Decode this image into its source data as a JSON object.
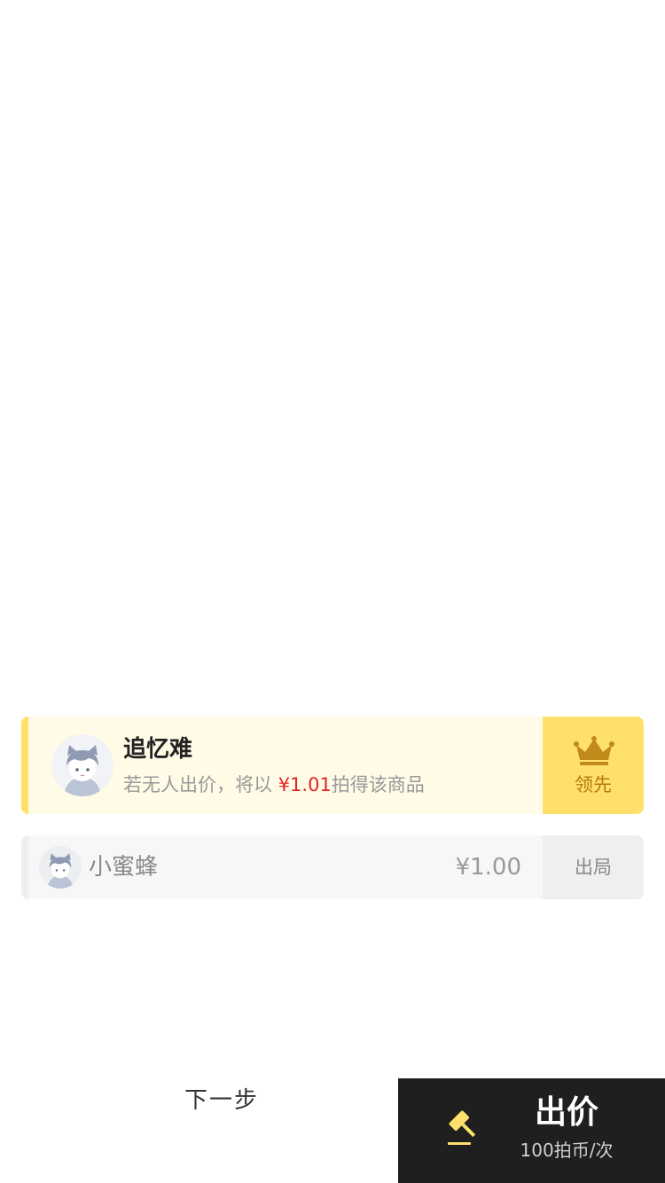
{
  "colors": {
    "accent_yellow": "#ffe06b",
    "leader_bg": "#fffbe6",
    "price_red": "#e02424",
    "crown_gold": "#c28a1a",
    "bid_button_bg": "#1f1f1f"
  },
  "leader": {
    "name": "追忆难",
    "desc_prefix": "若无人出价，将以 ",
    "desc_price": "¥1.01",
    "desc_suffix": "拍得该商品",
    "badge_label": "领先",
    "badge_icon": "crown-icon",
    "avatar_icon": "cat-ear-avatar"
  },
  "bidders": [
    {
      "name": "小蜜蜂",
      "amount": "¥1.00",
      "status": "出局",
      "avatar_icon": "cat-ear-avatar"
    }
  ],
  "footer": {
    "next_label": "下一步",
    "bid_label": "出价",
    "bid_cost": "100拍币/次",
    "bid_icon": "gavel-icon"
  }
}
